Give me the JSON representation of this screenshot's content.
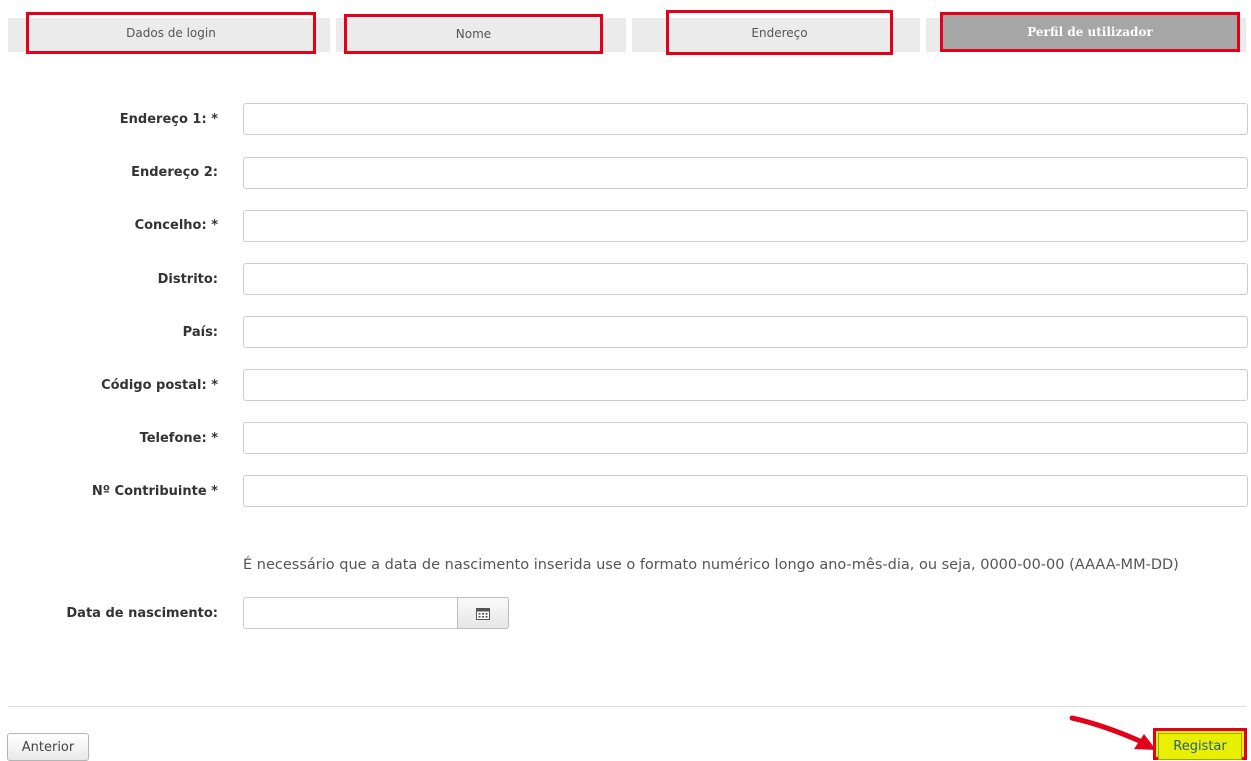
{
  "steps": [
    {
      "label": "Dados de login",
      "active": false
    },
    {
      "label": "Nome",
      "active": false
    },
    {
      "label": "Endereço",
      "active": false
    },
    {
      "label": "Perfil de utilizador",
      "active": true
    }
  ],
  "form": {
    "fields": [
      {
        "label": "Endereço 1: *",
        "value": ""
      },
      {
        "label": "Endereço 2:",
        "value": ""
      },
      {
        "label": "Concelho: *",
        "value": ""
      },
      {
        "label": "Distrito:",
        "value": ""
      },
      {
        "label": "País:",
        "value": ""
      },
      {
        "label": "Código postal: *",
        "value": ""
      },
      {
        "label": "Telefone: *",
        "value": ""
      },
      {
        "label": "Nº Contribuinte *",
        "value": ""
      }
    ],
    "birthdate": {
      "help": "É necessário que a data de nascimento inserida use o formato numérico longo ano-mês-dia, ou seja, 0000-00-00 (AAAA-MM-DD)",
      "label": "Data de nascimento:",
      "value": "",
      "calendar_icon": "calendar-icon"
    }
  },
  "buttons": {
    "previous": "Anterior",
    "register": "Registar"
  },
  "colors": {
    "highlight_border": "#e2001a",
    "active_step": "#a6a6a6",
    "register_bg": "#e8f000"
  }
}
